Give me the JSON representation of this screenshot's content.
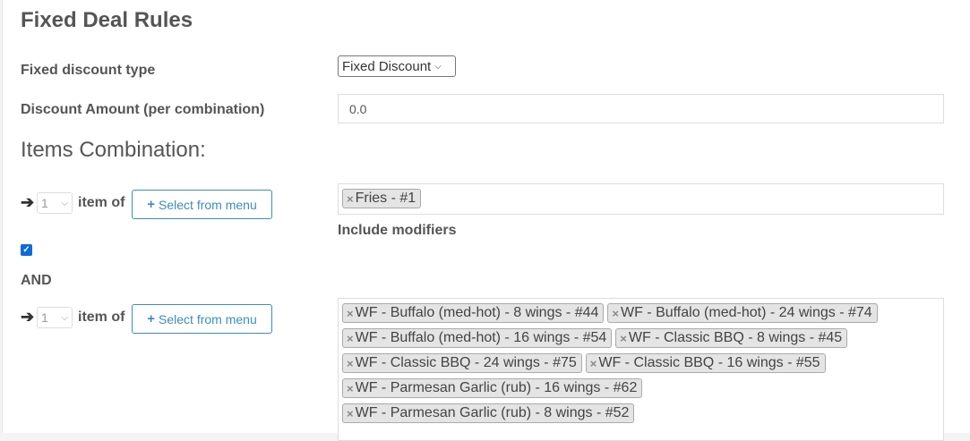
{
  "page": {
    "title": "Fixed Deal Rules"
  },
  "fields": {
    "discount_type_label": "Fixed discount type",
    "discount_type_value": "Fixed Discount",
    "discount_amount_label": "Discount Amount (per combination)",
    "discount_amount_value": "0.0"
  },
  "combination": {
    "heading": "Items Combination:",
    "and_label": "AND",
    "include_modifiers_label": "Include modifiers",
    "include_modifiers_checked": true,
    "rows": [
      {
        "arrow": "➔",
        "qty": "1",
        "item_of": "item of",
        "button_label": "Select from menu",
        "button_icon": "plus-icon",
        "tags": [
          "Fries - #1"
        ]
      },
      {
        "arrow": "➔",
        "qty": "1",
        "item_of": "item of",
        "button_label": "Select from menu",
        "button_icon": "plus-icon",
        "tags": [
          "WF - Buffalo (med-hot) - 8 wings - #44",
          "WF - Buffalo (med-hot) - 24 wings - #74",
          "WF - Buffalo (med-hot) - 16 wings - #54",
          "WF - Classic BBQ - 8 wings - #45",
          "WF - Classic BBQ - 24 wings - #75",
          "WF - Classic BBQ - 16 wings - #55",
          "WF - Parmesan Garlic (rub) - 16 wings - #62",
          "WF - Parmesan Garlic (rub) - 8 wings - #52"
        ]
      }
    ]
  },
  "colors": {
    "accent": "#3c8dbc",
    "checkbox": "#0b6bd8",
    "tag_bg": "#e4e4e4"
  }
}
